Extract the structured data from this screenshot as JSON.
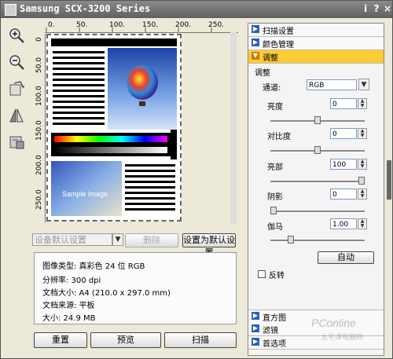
{
  "window": {
    "title": "Samsung SCX-3200 Series",
    "help_btn": "i",
    "question_btn": "?",
    "close_btn": "×"
  },
  "toolbar": {
    "icons": [
      "zoom-in-icon",
      "zoom-out-icon",
      "rotate-icon",
      "flip-icon",
      "print-preview-icon"
    ]
  },
  "ruler": {
    "h_ticks": [
      "0.",
      "50.",
      "100.",
      "150.",
      "200.",
      "250."
    ],
    "v_ticks": [
      "0",
      "50.0",
      "100.0",
      "150.0",
      "200.0",
      "250.0"
    ]
  },
  "preview": {
    "sample_label": "Sample Image"
  },
  "presets": {
    "combo_value": "设备默认设置",
    "delete_label": "删除",
    "set_default_label": "设置为默认设置"
  },
  "info": {
    "image_type": "图像类型: 真彩色 24 位 RGB",
    "resolution": "分辨率: 300 dpi",
    "doc_size": "文档大小: A4 (210.0 x 297.0 mm)",
    "doc_source": "文档来源: 平板",
    "size": "大小: 24.9 MB"
  },
  "bottom_buttons": {
    "reset": "重置",
    "preview": "预览",
    "scan": "扫描"
  },
  "panel": {
    "sections_top": [
      "扫描设置",
      "颜色管理",
      "调整"
    ],
    "adjust_title": "调整",
    "channel_label": "通道:",
    "channel_value": "RGB",
    "brightness_label": "亮度",
    "brightness_value": "0",
    "brightness_level": 0.5,
    "contrast_label": "对比度",
    "contrast_value": "0",
    "contrast_level": 0.5,
    "highlight_label": "亮部",
    "highlight_value": "100",
    "highlight_level": 1.0,
    "shadow_label": "阴影",
    "shadow_value": "0",
    "shadow_level": 0.0,
    "gamma_label": "伽马",
    "gamma_value": "1.00",
    "gamma_level": 0.2,
    "auto_label": "自动",
    "invert_label": "反转",
    "sections_bottom": [
      "直方图",
      "滤镜",
      "首选项"
    ]
  },
  "watermark": {
    "brand": "PConline",
    "tagline": "太平洋电脑网"
  }
}
